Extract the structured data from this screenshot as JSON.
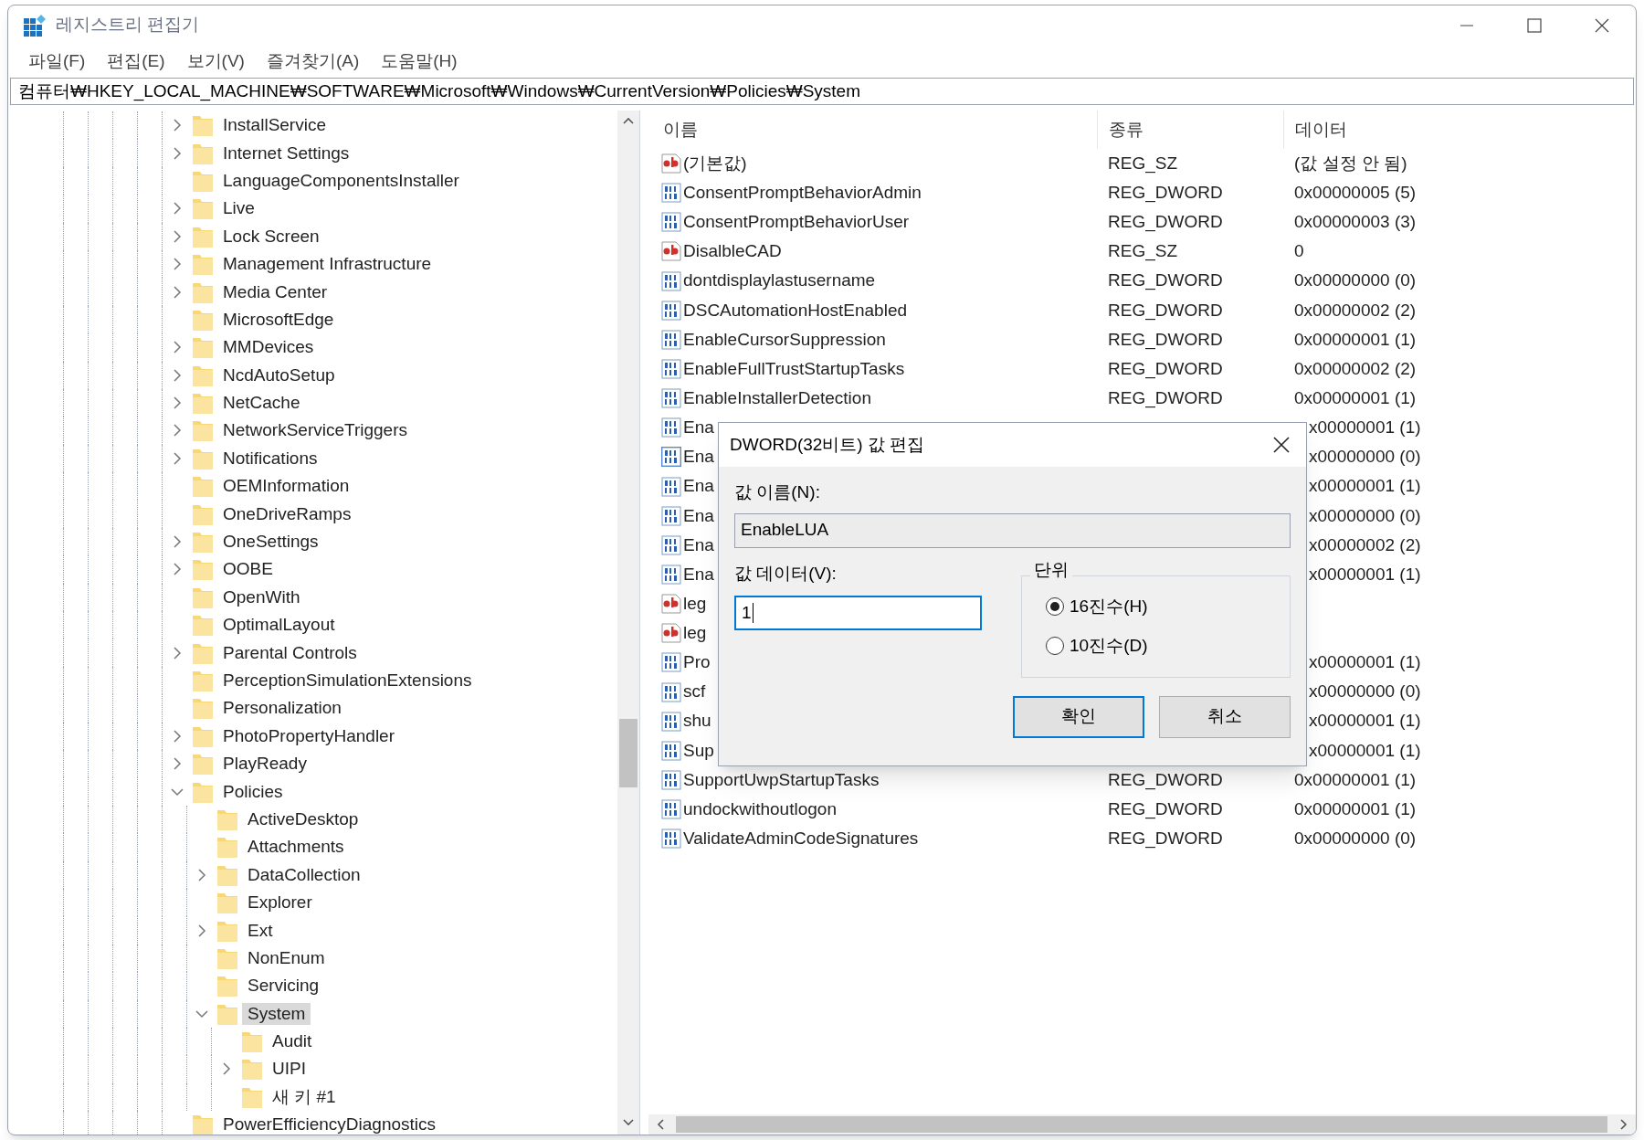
{
  "window": {
    "title": "레지스트리 편집기"
  },
  "menu": [
    "파일(F)",
    "편집(E)",
    "보기(V)",
    "즐겨찾기(A)",
    "도움말(H)"
  ],
  "address": "컴퓨터₩HKEY_LOCAL_MACHINE₩SOFTWARE₩Microsoft₩Windows₩CurrentVersion₩Policies₩System",
  "tree": [
    {
      "label": "InstallService",
      "expandable": true,
      "expanded": false,
      "selected": false
    },
    {
      "label": "Internet Settings",
      "expandable": true,
      "expanded": false,
      "selected": false
    },
    {
      "label": "LanguageComponentsInstaller",
      "expandable": false,
      "selected": false
    },
    {
      "label": "Live",
      "expandable": true,
      "expanded": false,
      "selected": false
    },
    {
      "label": "Lock Screen",
      "expandable": true,
      "expanded": false,
      "selected": false
    },
    {
      "label": "Management Infrastructure",
      "expandable": true,
      "expanded": false,
      "selected": false
    },
    {
      "label": "Media Center",
      "expandable": true,
      "expanded": false,
      "selected": false
    },
    {
      "label": "MicrosoftEdge",
      "expandable": false,
      "selected": false
    },
    {
      "label": "MMDevices",
      "expandable": true,
      "expanded": false,
      "selected": false
    },
    {
      "label": "NcdAutoSetup",
      "expandable": true,
      "expanded": false,
      "selected": false
    },
    {
      "label": "NetCache",
      "expandable": true,
      "expanded": false,
      "selected": false
    },
    {
      "label": "NetworkServiceTriggers",
      "expandable": true,
      "expanded": false,
      "selected": false
    },
    {
      "label": "Notifications",
      "expandable": true,
      "expanded": false,
      "selected": false
    },
    {
      "label": "OEMInformation",
      "expandable": false,
      "selected": false
    },
    {
      "label": "OneDriveRamps",
      "expandable": false,
      "selected": false
    },
    {
      "label": "OneSettings",
      "expandable": true,
      "expanded": false,
      "selected": false
    },
    {
      "label": "OOBE",
      "expandable": true,
      "expanded": false,
      "selected": false
    },
    {
      "label": "OpenWith",
      "expandable": false,
      "selected": false
    },
    {
      "label": "OptimalLayout",
      "expandable": false,
      "selected": false
    },
    {
      "label": "Parental Controls",
      "expandable": true,
      "expanded": false,
      "selected": false
    },
    {
      "label": "PerceptionSimulationExtensions",
      "expandable": false,
      "selected": false
    },
    {
      "label": "Personalization",
      "expandable": false,
      "selected": false
    },
    {
      "label": "PhotoPropertyHandler",
      "expandable": true,
      "expanded": false,
      "selected": false
    },
    {
      "label": "PlayReady",
      "expandable": true,
      "expanded": false,
      "selected": false
    },
    {
      "label": "Policies",
      "expandable": true,
      "expanded": true,
      "selected": false,
      "children": [
        {
          "label": "ActiveDesktop",
          "expandable": false,
          "selected": false
        },
        {
          "label": "Attachments",
          "expandable": false,
          "selected": false
        },
        {
          "label": "DataCollection",
          "expandable": true,
          "expanded": false,
          "selected": false
        },
        {
          "label": "Explorer",
          "expandable": false,
          "selected": false
        },
        {
          "label": "Ext",
          "expandable": true,
          "expanded": false,
          "selected": false
        },
        {
          "label": "NonEnum",
          "expandable": false,
          "selected": false
        },
        {
          "label": "Servicing",
          "expandable": false,
          "selected": false
        },
        {
          "label": "System",
          "expandable": true,
          "expanded": true,
          "selected": true,
          "children": [
            {
              "label": "Audit",
              "expandable": false,
              "selected": false
            },
            {
              "label": "UIPI",
              "expandable": true,
              "expanded": false,
              "selected": false
            },
            {
              "label": "새 키 #1",
              "expandable": false,
              "selected": false
            }
          ]
        }
      ]
    },
    {
      "label": "PowerEfficiencyDiagnostics",
      "expandable": false,
      "selected": false
    }
  ],
  "list": {
    "columns": [
      "이름",
      "종류",
      "데이터"
    ],
    "rows": [
      {
        "name": "(기본값)",
        "kind": "string",
        "type": "REG_SZ",
        "data": "(값 설정 안 됨)",
        "selected": false
      },
      {
        "name": "ConsentPromptBehaviorAdmin",
        "kind": "dword",
        "type": "REG_DWORD",
        "data": "0x00000005 (5)",
        "selected": false
      },
      {
        "name": "ConsentPromptBehaviorUser",
        "kind": "dword",
        "type": "REG_DWORD",
        "data": "0x00000003 (3)",
        "selected": false
      },
      {
        "name": "DisalbleCAD",
        "kind": "string",
        "type": "REG_SZ",
        "data": "0",
        "selected": false
      },
      {
        "name": "dontdisplaylastusername",
        "kind": "dword",
        "type": "REG_DWORD",
        "data": "0x00000000 (0)",
        "selected": false
      },
      {
        "name": "DSCAutomationHostEnabled",
        "kind": "dword",
        "type": "REG_DWORD",
        "data": "0x00000002 (2)",
        "selected": false
      },
      {
        "name": "EnableCursorSuppression",
        "kind": "dword",
        "type": "REG_DWORD",
        "data": "0x00000001 (1)",
        "selected": false
      },
      {
        "name": "EnableFullTrustStartupTasks",
        "kind": "dword",
        "type": "REG_DWORD",
        "data": "0x00000002 (2)",
        "selected": false
      },
      {
        "name": "EnableInstallerDetection",
        "kind": "dword",
        "type": "REG_DWORD",
        "data": "0x00000001 (1)",
        "selected": false
      },
      {
        "name": "Ena",
        "kind": "dword",
        "data": "x00000001 (1)",
        "selected": false
      },
      {
        "name": "Ena",
        "kind": "dword",
        "data": "x00000000 (0)",
        "selected": true
      },
      {
        "name": "Ena",
        "kind": "dword",
        "data": "x00000001 (1)",
        "selected": false
      },
      {
        "name": "Ena",
        "kind": "dword",
        "data": "x00000000 (0)",
        "selected": false
      },
      {
        "name": "Ena",
        "kind": "dword",
        "data": "x00000002 (2)",
        "selected": false
      },
      {
        "name": "Ena",
        "kind": "dword",
        "data": "x00000001 (1)",
        "selected": false
      },
      {
        "name": "leg",
        "kind": "string",
        "selected": false
      },
      {
        "name": "leg",
        "kind": "string",
        "selected": false
      },
      {
        "name": "Pro",
        "kind": "dword",
        "data": "x00000001 (1)",
        "selected": false
      },
      {
        "name": "scf",
        "kind": "dword",
        "data": "x00000000 (0)",
        "selected": false
      },
      {
        "name": "shu",
        "kind": "dword",
        "data": "x00000001 (1)",
        "selected": false
      },
      {
        "name": "Sup",
        "kind": "dword",
        "data": "x00000001 (1)",
        "selected": false
      },
      {
        "name": "SupportUwpStartupTasks",
        "kind": "dword",
        "type": "REG_DWORD",
        "data": "0x00000001 (1)",
        "selected": false
      },
      {
        "name": "undockwithoutlogon",
        "kind": "dword",
        "type": "REG_DWORD",
        "data": "0x00000001 (1)",
        "selected": false
      },
      {
        "name": "ValidateAdminCodeSignatures",
        "kind": "dword",
        "type": "REG_DWORD",
        "data": "0x00000000 (0)",
        "selected": false
      }
    ]
  },
  "dialog": {
    "title": "DWORD(32비트) 값 편집",
    "name_label": "값 이름(N):",
    "name_value": "EnableLUA",
    "data_label": "값 데이터(V):",
    "data_value": "1",
    "unit_label": "단위",
    "radios": [
      {
        "label": "16진수(H)",
        "selected": true
      },
      {
        "label": "10진수(D)",
        "selected": false
      }
    ],
    "buttons": [
      {
        "label": "확인",
        "default": true
      },
      {
        "label": "취소",
        "default": false
      }
    ]
  }
}
